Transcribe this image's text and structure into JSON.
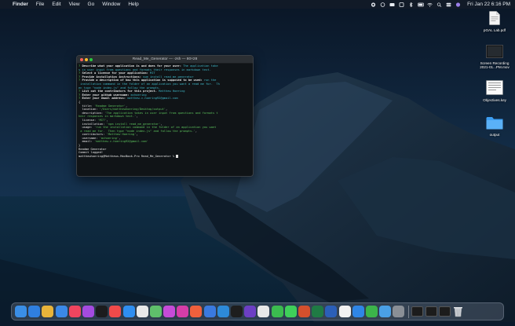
{
  "menubar": {
    "apple_glyph": "",
    "menus": [
      "Finder",
      "File",
      "Edit",
      "View",
      "Go",
      "Window",
      "Help"
    ],
    "clock": "Fri Jan 22  6:16 PM"
  },
  "desktop_icons": [
    {
      "label": "pGAL Lab.pdf"
    },
    {
      "label": "Screen Recording 2021-01...PM.mov"
    },
    {
      "label": "Objectives.key"
    },
    {
      "label": "output"
    }
  ],
  "terminal": {
    "title": "Read_Me_Generator — -zsh — 80×28",
    "lines": [
      [
        {
          "c": "q",
          "t": "? "
        },
        {
          "c": "b",
          "t": "Describe what your application is and does for your user: "
        },
        {
          "c": "a",
          "t": "The application take"
        }
      ],
      [
        {
          "c": "a",
          "t": "s in user input from questions and formats their responses in markdown text."
        }
      ],
      [
        {
          "c": "q",
          "t": "? "
        },
        {
          "c": "b",
          "t": "Select a license for your application: "
        },
        {
          "c": "a",
          "t": "MIT"
        }
      ],
      [
        {
          "c": "q",
          "t": "? "
        },
        {
          "c": "b",
          "t": "Provide installation instructions: "
        },
        {
          "c": "a",
          "t": "npm install read_me_generator"
        }
      ],
      [
        {
          "c": "q",
          "t": "? "
        },
        {
          "c": "b",
          "t": "Provide a description of how this application is supposed to be used: "
        },
        {
          "c": "a",
          "t": "run the"
        }
      ],
      [
        {
          "c": "a",
          "t": " installation command in the folder of an application you want a read me for.  Th"
        }
      ],
      [
        {
          "c": "a",
          "t": "en type \"node index.js\" and follow the prompts."
        }
      ],
      [
        {
          "c": "q",
          "t": "? "
        },
        {
          "c": "b",
          "t": "List out the contributors for this project. "
        },
        {
          "c": "a",
          "t": "Matthew Hoering"
        }
      ],
      [
        {
          "c": "q",
          "t": "? "
        },
        {
          "c": "b",
          "t": "Enter your github username: "
        },
        {
          "c": "a",
          "t": "mchoering"
        }
      ],
      [
        {
          "c": "q",
          "t": "? "
        },
        {
          "c": "b",
          "t": "Enter your email address: "
        },
        {
          "c": "a",
          "t": "matthew.c.hoering92@gmail.com"
        }
      ],
      [
        {
          "c": "",
          "t": "{"
        }
      ],
      [
        {
          "c": "",
          "t": "  title: "
        },
        {
          "c": "s",
          "t": "'Readme Generator'"
        },
        {
          "c": "",
          "t": ","
        }
      ],
      [
        {
          "c": "",
          "t": "  location: "
        },
        {
          "c": "s",
          "t": "'/Users/matthewhoering/Desktop/output'"
        },
        {
          "c": "",
          "t": ","
        }
      ],
      [
        {
          "c": "",
          "t": "  description: "
        },
        {
          "c": "s",
          "t": "'The application takes in user input from questions and formats t"
        }
      ],
      [
        {
          "c": "s",
          "t": "heir responses in markdown text.'"
        },
        {
          "c": "",
          "t": ","
        }
      ],
      [
        {
          "c": "",
          "t": "  license: "
        },
        {
          "c": "s",
          "t": "'MIT'"
        },
        {
          "c": "",
          "t": ","
        }
      ],
      [
        {
          "c": "",
          "t": "  installation: "
        },
        {
          "c": "s",
          "t": "'npm install read_me_generator'"
        },
        {
          "c": "",
          "t": ","
        }
      ],
      [
        {
          "c": "",
          "t": "  usage: "
        },
        {
          "c": "s",
          "t": "'run the installation command in the folder of an application you want"
        }
      ],
      [
        {
          "c": "s",
          "t": " a read me for.  Then type \"node index.js\" and follow the prompts.'"
        },
        {
          "c": "",
          "t": ","
        }
      ],
      [
        {
          "c": "",
          "t": "  contributors: "
        },
        {
          "c": "s",
          "t": "'Matthew Hoering'"
        },
        {
          "c": "",
          "t": ","
        }
      ],
      [
        {
          "c": "",
          "t": "  username: "
        },
        {
          "c": "s",
          "t": "'mchoering'"
        },
        {
          "c": "",
          "t": ","
        }
      ],
      [
        {
          "c": "",
          "t": "  email: "
        },
        {
          "c": "s",
          "t": "'matthew.c.hoering92@gmail.com'"
        }
      ],
      [
        {
          "c": "",
          "t": "}"
        }
      ],
      [
        {
          "c": "",
          "t": "Readme Generator"
        }
      ],
      [
        {
          "c": "",
          "t": "Commit logged!"
        }
      ],
      [
        {
          "c": "",
          "t": "matthewhoering@Matthews-MacBook-Pro Read_Me_Generator % "
        }
      ]
    ]
  },
  "colors": {
    "sky_top": "#0a1626",
    "sky_bottom": "#1b3a5a",
    "ocean": "#0d2a3f",
    "terminal_bg": "#101417",
    "prompt_green": "#53c653",
    "answer_cyan": "#3fb8c8"
  },
  "dock": {
    "apps": [
      {
        "icon": "finder-icon",
        "color": "#3a8ee6"
      },
      {
        "icon": "safari-icon",
        "color": "#2f7fe0"
      },
      {
        "icon": "chrome-icon",
        "color": "#e9b43a"
      },
      {
        "icon": "mail-icon",
        "color": "#3b89e8"
      },
      {
        "icon": "music-icon",
        "color": "#f0455f"
      },
      {
        "icon": "podcasts-icon",
        "color": "#a44be0"
      },
      {
        "icon": "tv-icon",
        "color": "#1c1c1e"
      },
      {
        "icon": "news-icon",
        "color": "#f04a4a"
      },
      {
        "icon": "app-store-icon",
        "color": "#2f8ef0"
      },
      {
        "icon": "photos-icon",
        "color": "#e8e8e8"
      },
      {
        "icon": "maps-icon",
        "color": "#5fbf6b"
      },
      {
        "icon": "affinity-icon",
        "color": "#c64bd8"
      },
      {
        "icon": "spotlight-icon",
        "color": "#d63da8"
      },
      {
        "icon": "swift-icon",
        "color": "#f0603c"
      },
      {
        "icon": "xcode-icon",
        "color": "#3a7ae0"
      },
      {
        "icon": "vscode-icon",
        "color": "#2d8ad9"
      },
      {
        "icon": "terminal-icon",
        "color": "#1e1e1e"
      },
      {
        "icon": "github-icon",
        "color": "#6c3fc4"
      },
      {
        "icon": "slack-icon",
        "color": "#e8e8e8"
      },
      {
        "icon": "whatsapp-icon",
        "color": "#3bbb4f"
      },
      {
        "icon": "messages-icon",
        "color": "#3fcf5a"
      },
      {
        "icon": "powerpoint-icon",
        "color": "#d4502d"
      },
      {
        "icon": "excel-icon",
        "color": "#1f7a44"
      },
      {
        "icon": "word-icon",
        "color": "#2b5fb8"
      },
      {
        "icon": "textedit-icon",
        "color": "#f2f2f2"
      },
      {
        "icon": "keynote-icon",
        "color": "#2f86e6"
      },
      {
        "icon": "numbers-icon",
        "color": "#3cb44a"
      },
      {
        "icon": "preview-icon",
        "color": "#4aa0e6"
      },
      {
        "icon": "system-preferences-icon",
        "color": "#8a8f96"
      }
    ]
  }
}
